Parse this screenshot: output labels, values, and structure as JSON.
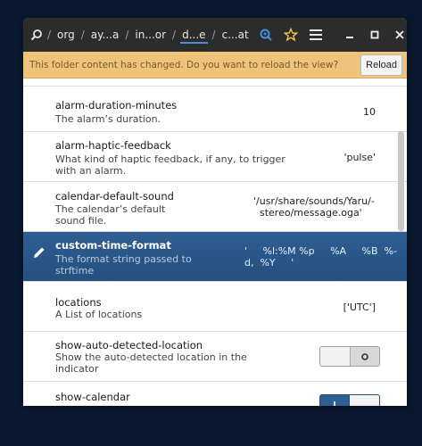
{
  "breadcrumbs": [
    "org",
    "ay...a",
    "in...or",
    "d...e",
    "c...at"
  ],
  "infobar": {
    "message": "This folder content has changed. Do you want to reload the view?",
    "reload_label": "Reload"
  },
  "rows": [
    {
      "name": "alarm-duration-minutes",
      "desc": "The alarm’s duration.",
      "value": "10"
    },
    {
      "name": "alarm-haptic-feedback",
      "desc_line1": "What kind of haptic feedback, if any, to trigger",
      "desc_line2": "with an alarm.",
      "value": "'pulse'"
    },
    {
      "name": "calendar-default-sound",
      "desc_line1": "The calendar’s default",
      "desc_line2": "sound file.",
      "value_line1": "'/usr/share/sounds/Yaru/-",
      "value_line2": "stereo/message.oga'"
    },
    {
      "name": "custom-time-format",
      "desc_line1": "The format string passed to",
      "desc_line2": "strftime",
      "value_line1": "'     %l:%M %p     %A     %B  %-",
      "value_line2": "d,  %Y     '"
    },
    {
      "name": "locations",
      "desc": "A List of locations",
      "value": "['UTC']"
    },
    {
      "name": "show-auto-detected-location",
      "desc_line1": "Show the auto-detected location in the",
      "desc_line2": "indicator",
      "toggle": false
    },
    {
      "name": "show-calendar",
      "toggle": true
    }
  ],
  "colors": {
    "headerbar": "#2c2c2c",
    "infobar": "#f0c37a",
    "selected_row": "#2f5e92"
  }
}
